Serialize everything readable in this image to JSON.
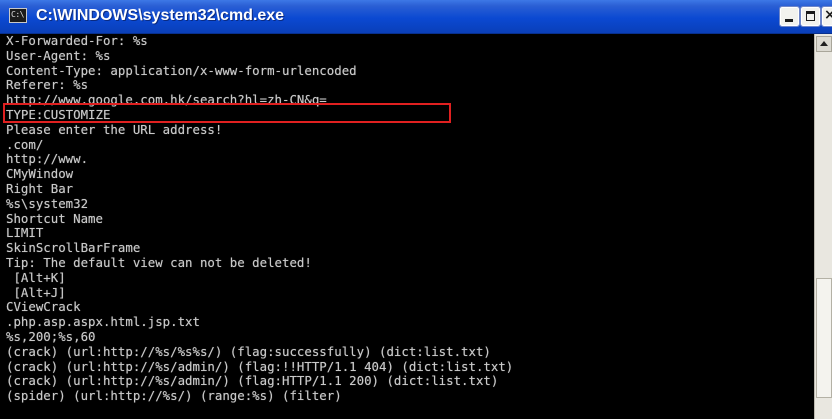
{
  "window": {
    "title": "C:\\WINDOWS\\system32\\cmd.exe",
    "icon": "cmd-icon",
    "icon_text": "C:\\",
    "buttons": {
      "minimize": "minimize-icon",
      "maximize": "maximize-icon",
      "close": "×"
    }
  },
  "console": {
    "lines": [
      "X-Forwarded-For: %s",
      "User-Agent: %s",
      "Content-Type: application/x-www-form-urlencoded",
      "Referer: %s",
      "http://www.google.com.hk/search?hl=zh-CN&q=",
      "TYPE:CUSTOMIZE",
      "Please enter the URL address!",
      ".com/",
      "http://www.",
      "CMyWindow",
      "Right Bar",
      "%s\\system32",
      "Shortcut Name",
      "LIMIT",
      "SkinScrollBarFrame",
      "Tip: The default view can not be deleted!",
      " [Alt+K]",
      " [Alt+J]",
      "CViewCrack",
      ".php.asp.aspx.html.jsp.txt",
      "%s,200;%s,60",
      "(crack) (url:http://%s/%s%s/) (flag:successfully) (dict:list.txt)",
      "(crack) (url:http://%s/admin/) (flag:!!HTTP/1.1 404) (dict:list.txt)",
      "(crack) (url:http://%s/admin/) (flag:HTTP/1.1 200) (dict:list.txt)",
      "(spider) (url:http://%s/) (range:%s) (filter)"
    ],
    "text_color": "#c9c9c9",
    "background": "#000000",
    "highlight_color": "#e02020",
    "highlighted_line": "http://www.google.com.hk/search?hl=zh-CN&q="
  }
}
